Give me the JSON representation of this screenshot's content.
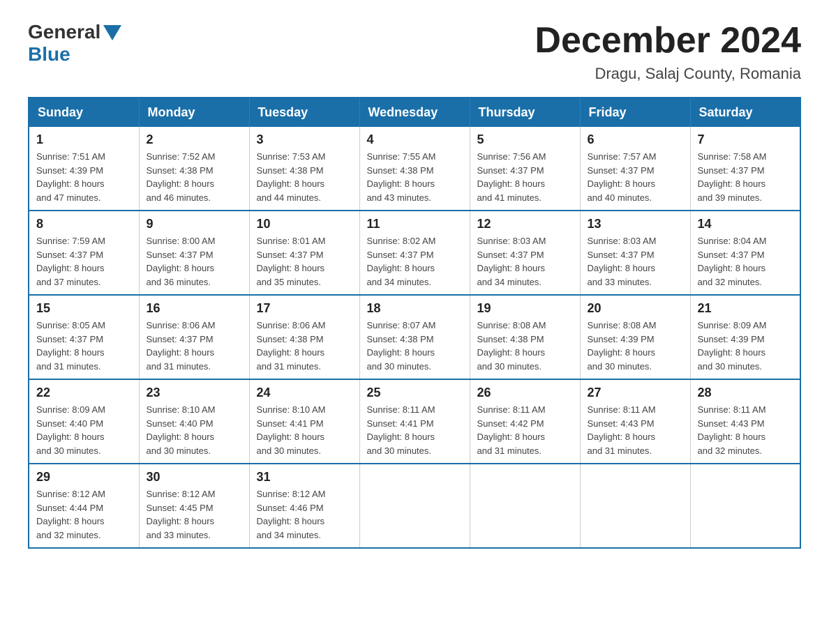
{
  "logo": {
    "general": "General",
    "triangle": "▶",
    "blue": "Blue"
  },
  "title": {
    "month": "December 2024",
    "location": "Dragu, Salaj County, Romania"
  },
  "header_days": [
    "Sunday",
    "Monday",
    "Tuesday",
    "Wednesday",
    "Thursday",
    "Friday",
    "Saturday"
  ],
  "weeks": [
    [
      {
        "day": "1",
        "sunrise": "7:51 AM",
        "sunset": "4:39 PM",
        "daylight": "8 hours and 47 minutes."
      },
      {
        "day": "2",
        "sunrise": "7:52 AM",
        "sunset": "4:38 PM",
        "daylight": "8 hours and 46 minutes."
      },
      {
        "day": "3",
        "sunrise": "7:53 AM",
        "sunset": "4:38 PM",
        "daylight": "8 hours and 44 minutes."
      },
      {
        "day": "4",
        "sunrise": "7:55 AM",
        "sunset": "4:38 PM",
        "daylight": "8 hours and 43 minutes."
      },
      {
        "day": "5",
        "sunrise": "7:56 AM",
        "sunset": "4:37 PM",
        "daylight": "8 hours and 41 minutes."
      },
      {
        "day": "6",
        "sunrise": "7:57 AM",
        "sunset": "4:37 PM",
        "daylight": "8 hours and 40 minutes."
      },
      {
        "day": "7",
        "sunrise": "7:58 AM",
        "sunset": "4:37 PM",
        "daylight": "8 hours and 39 minutes."
      }
    ],
    [
      {
        "day": "8",
        "sunrise": "7:59 AM",
        "sunset": "4:37 PM",
        "daylight": "8 hours and 37 minutes."
      },
      {
        "day": "9",
        "sunrise": "8:00 AM",
        "sunset": "4:37 PM",
        "daylight": "8 hours and 36 minutes."
      },
      {
        "day": "10",
        "sunrise": "8:01 AM",
        "sunset": "4:37 PM",
        "daylight": "8 hours and 35 minutes."
      },
      {
        "day": "11",
        "sunrise": "8:02 AM",
        "sunset": "4:37 PM",
        "daylight": "8 hours and 34 minutes."
      },
      {
        "day": "12",
        "sunrise": "8:03 AM",
        "sunset": "4:37 PM",
        "daylight": "8 hours and 34 minutes."
      },
      {
        "day": "13",
        "sunrise": "8:03 AM",
        "sunset": "4:37 PM",
        "daylight": "8 hours and 33 minutes."
      },
      {
        "day": "14",
        "sunrise": "8:04 AM",
        "sunset": "4:37 PM",
        "daylight": "8 hours and 32 minutes."
      }
    ],
    [
      {
        "day": "15",
        "sunrise": "8:05 AM",
        "sunset": "4:37 PM",
        "daylight": "8 hours and 31 minutes."
      },
      {
        "day": "16",
        "sunrise": "8:06 AM",
        "sunset": "4:37 PM",
        "daylight": "8 hours and 31 minutes."
      },
      {
        "day": "17",
        "sunrise": "8:06 AM",
        "sunset": "4:38 PM",
        "daylight": "8 hours and 31 minutes."
      },
      {
        "day": "18",
        "sunrise": "8:07 AM",
        "sunset": "4:38 PM",
        "daylight": "8 hours and 30 minutes."
      },
      {
        "day": "19",
        "sunrise": "8:08 AM",
        "sunset": "4:38 PM",
        "daylight": "8 hours and 30 minutes."
      },
      {
        "day": "20",
        "sunrise": "8:08 AM",
        "sunset": "4:39 PM",
        "daylight": "8 hours and 30 minutes."
      },
      {
        "day": "21",
        "sunrise": "8:09 AM",
        "sunset": "4:39 PM",
        "daylight": "8 hours and 30 minutes."
      }
    ],
    [
      {
        "day": "22",
        "sunrise": "8:09 AM",
        "sunset": "4:40 PM",
        "daylight": "8 hours and 30 minutes."
      },
      {
        "day": "23",
        "sunrise": "8:10 AM",
        "sunset": "4:40 PM",
        "daylight": "8 hours and 30 minutes."
      },
      {
        "day": "24",
        "sunrise": "8:10 AM",
        "sunset": "4:41 PM",
        "daylight": "8 hours and 30 minutes."
      },
      {
        "day": "25",
        "sunrise": "8:11 AM",
        "sunset": "4:41 PM",
        "daylight": "8 hours and 30 minutes."
      },
      {
        "day": "26",
        "sunrise": "8:11 AM",
        "sunset": "4:42 PM",
        "daylight": "8 hours and 31 minutes."
      },
      {
        "day": "27",
        "sunrise": "8:11 AM",
        "sunset": "4:43 PM",
        "daylight": "8 hours and 31 minutes."
      },
      {
        "day": "28",
        "sunrise": "8:11 AM",
        "sunset": "4:43 PM",
        "daylight": "8 hours and 32 minutes."
      }
    ],
    [
      {
        "day": "29",
        "sunrise": "8:12 AM",
        "sunset": "4:44 PM",
        "daylight": "8 hours and 32 minutes."
      },
      {
        "day": "30",
        "sunrise": "8:12 AM",
        "sunset": "4:45 PM",
        "daylight": "8 hours and 33 minutes."
      },
      {
        "day": "31",
        "sunrise": "8:12 AM",
        "sunset": "4:46 PM",
        "daylight": "8 hours and 34 minutes."
      },
      null,
      null,
      null,
      null
    ]
  ]
}
